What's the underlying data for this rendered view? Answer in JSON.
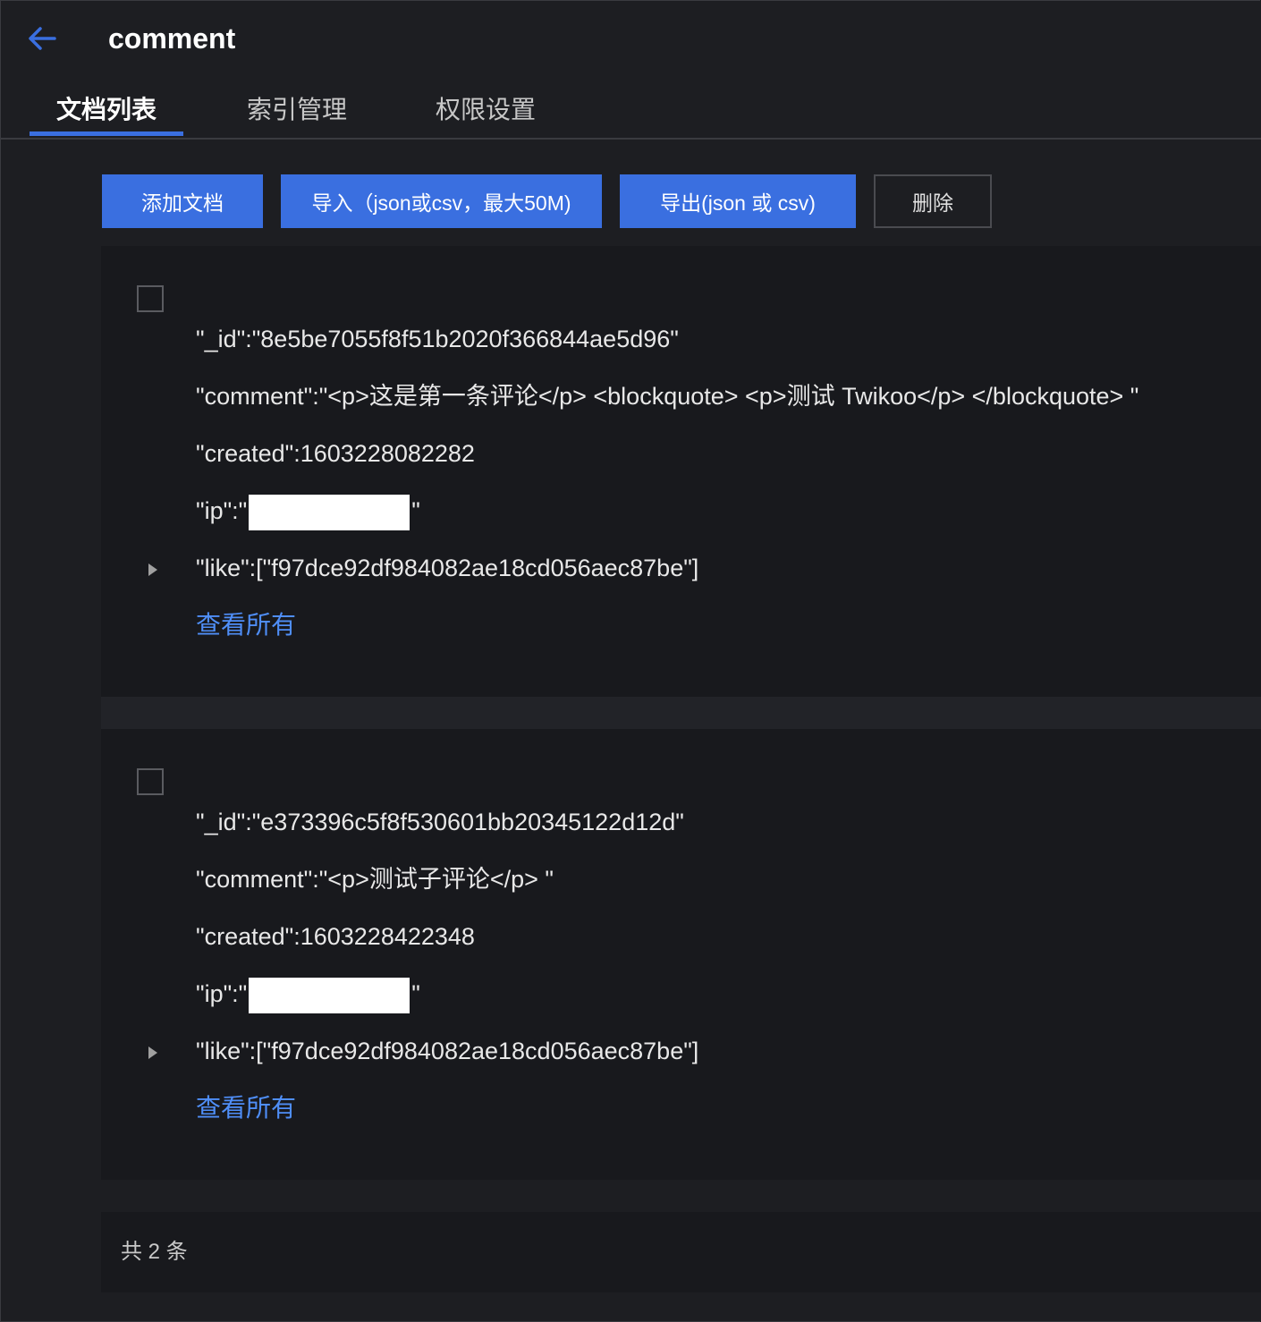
{
  "header": {
    "title": "comment"
  },
  "tabs": [
    {
      "label": "文档列表",
      "active": true
    },
    {
      "label": "索引管理",
      "active": false
    },
    {
      "label": "权限设置",
      "active": false
    }
  ],
  "toolbar": {
    "add_label": "添加文档",
    "import_label": "导入（json或csv，最大50M)",
    "export_label": "导出(json 或 csv)",
    "delete_label": "删除"
  },
  "documents": [
    {
      "id_line": "\"_id\":\"8e5be7055f8f51b2020f366844ae5d96\"",
      "comment_line": "\"comment\":\"<p>这是第一条评论</p> <blockquote> <p>测试 Twikoo</p> </blockquote> \"",
      "created_line": "\"created\":1603228082282",
      "ip_prefix": "\"ip\":\"",
      "ip_suffix": "\"",
      "like_line": "\"like\":[\"f97dce92df984082ae18cd056aec87be\"]",
      "view_all": "查看所有"
    },
    {
      "id_line": "\"_id\":\"e373396c5f8f530601bb20345122d12d\"",
      "comment_line": "\"comment\":\"<p>测试子评论</p> \"",
      "created_line": "\"created\":1603228422348",
      "ip_prefix": "\"ip\":\"",
      "ip_suffix": "\"",
      "like_line": "\"like\":[\"f97dce92df984082ae18cd056aec87be\"]",
      "view_all": "查看所有"
    }
  ],
  "footer": {
    "total": "共 2 条"
  },
  "colors": {
    "accent": "#3a6fe0",
    "link": "#4f8ef7",
    "background": "#1d1e22"
  },
  "icons": {
    "back": "arrow-left-icon",
    "expand": "caret-right-icon"
  }
}
